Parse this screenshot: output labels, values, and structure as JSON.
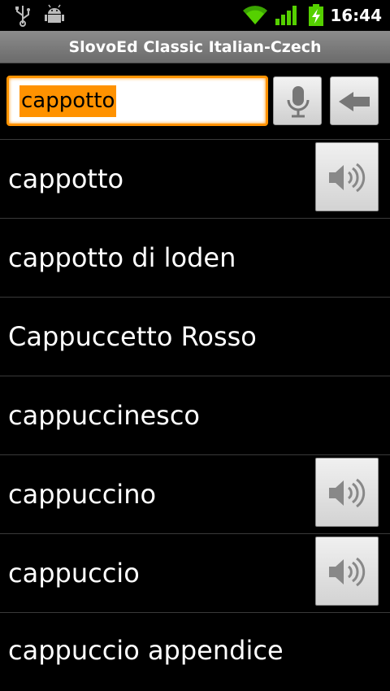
{
  "status_bar": {
    "time": "16:44",
    "icons": [
      "usb-icon",
      "android-debug-icon",
      "wifi-icon",
      "signal-icon",
      "battery-charging-icon"
    ]
  },
  "title_bar": {
    "title": "SlovoEd Classic Italian-Czech"
  },
  "search": {
    "value": "cappotto",
    "mic_icon": "microphone-icon",
    "back_icon": "backspace-arrow-icon",
    "accent_color": "#ff9200"
  },
  "results": [
    {
      "label": "cappotto",
      "has_audio": true
    },
    {
      "label": "cappotto di loden",
      "has_audio": false
    },
    {
      "label": "Cappuccetto Rosso",
      "has_audio": false
    },
    {
      "label": "cappuccinesco",
      "has_audio": false
    },
    {
      "label": "cappuccino",
      "has_audio": true
    },
    {
      "label": "cappuccio",
      "has_audio": true
    },
    {
      "label": "cappuccio appendice",
      "has_audio": false
    }
  ]
}
